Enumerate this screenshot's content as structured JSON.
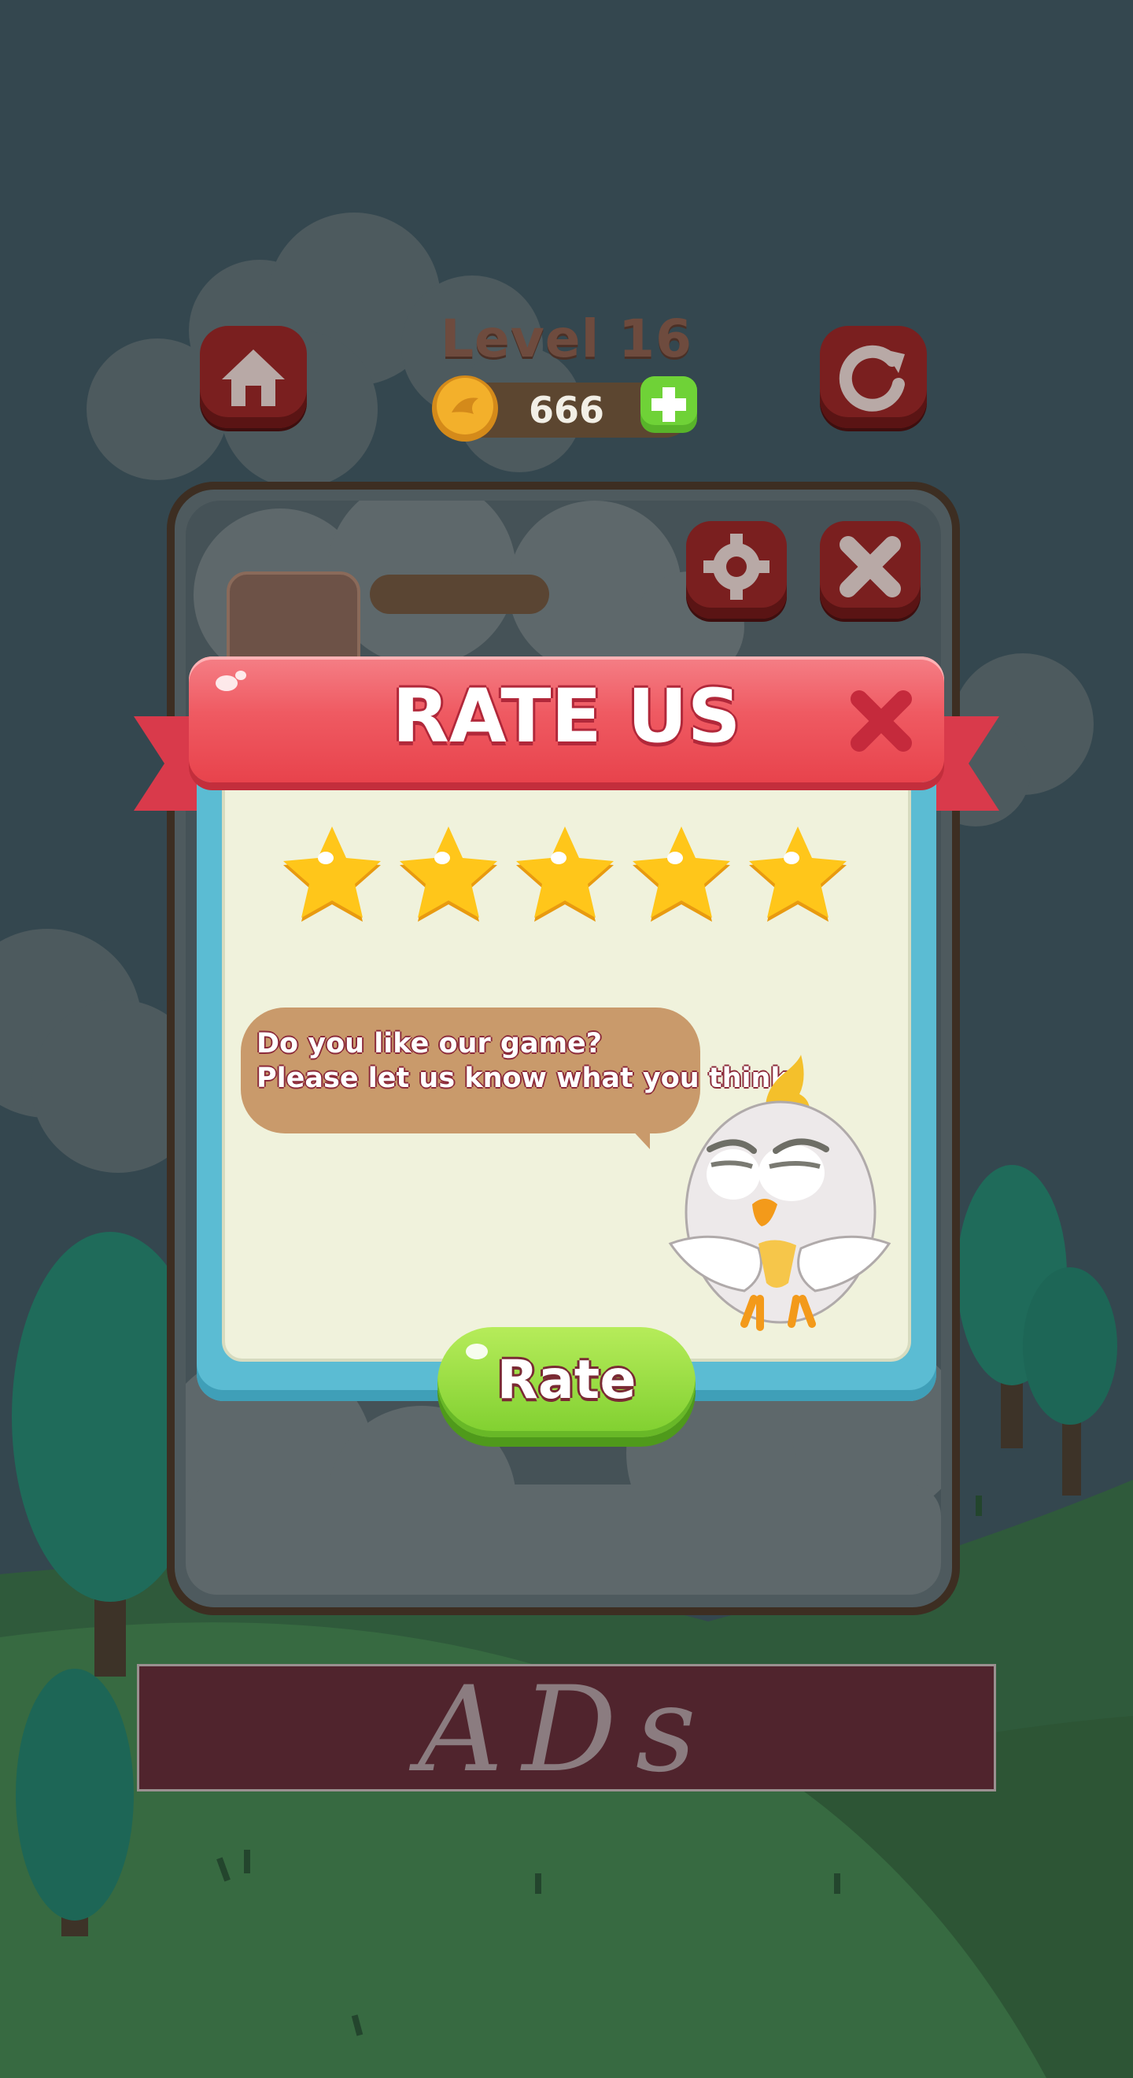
{
  "hud": {
    "level_title": "Level 16",
    "coins": "666",
    "home_icon": "home-icon",
    "restart_icon": "restart-icon",
    "settings_icon": "gear-icon",
    "close_icon": "close-icon"
  },
  "dialog": {
    "title": "RATE US",
    "stars_shown": 5,
    "message_line1": "Do you like our game?",
    "message_line2": "Please let us know what you think",
    "rate_button": "Rate"
  },
  "ads": {
    "label": "ADs"
  },
  "colors": {
    "title_red": "#ef5a62",
    "frame_blue": "#5bbcd3",
    "panel_cream": "#f0f2dc",
    "bubble_tan": "#c99a6b",
    "button_green": "#8fd93a",
    "star_gold": "#ffc61a"
  }
}
